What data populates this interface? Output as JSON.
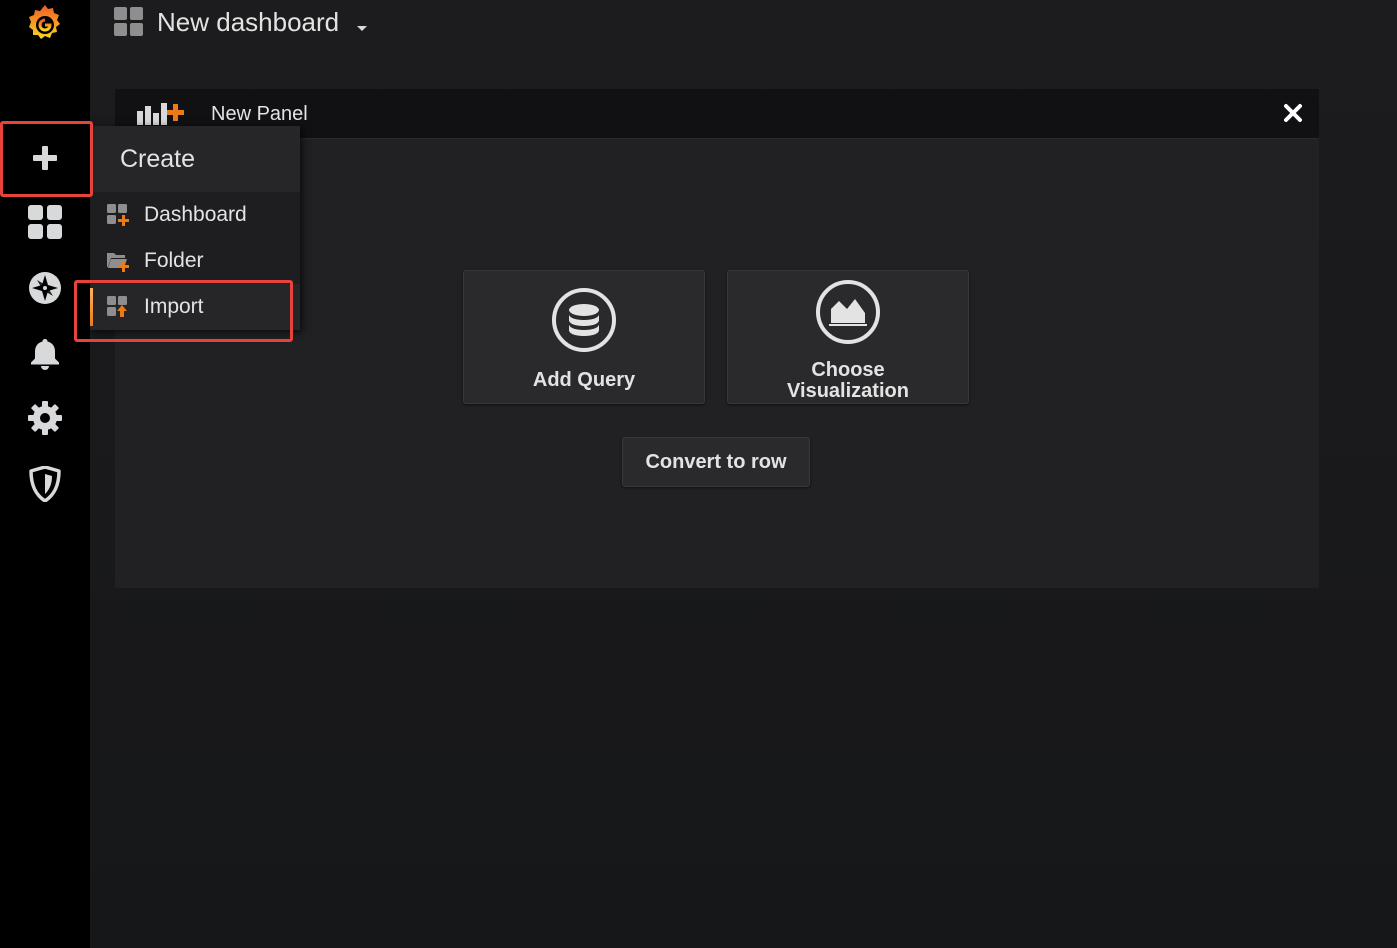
{
  "navbar": {
    "dashboard_title": "New dashboard"
  },
  "sidemenu": {
    "items": [
      {
        "name": "grafana-logo",
        "icon": "grafana-logo-icon"
      },
      {
        "name": "create",
        "icon": "plus-icon",
        "active": true
      },
      {
        "name": "dashboards",
        "icon": "apps-grid-icon"
      },
      {
        "name": "explore",
        "icon": "compass-icon"
      },
      {
        "name": "alerting",
        "icon": "bell-icon"
      },
      {
        "name": "configuration",
        "icon": "gear-icon"
      },
      {
        "name": "server-admin",
        "icon": "shield-icon"
      }
    ],
    "create_menu": {
      "title": "Create",
      "items": [
        {
          "label": "Dashboard",
          "icon": "dashboard-add-icon"
        },
        {
          "label": "Folder",
          "icon": "folder-add-icon"
        },
        {
          "label": "Import",
          "icon": "import-icon",
          "active": true
        }
      ]
    }
  },
  "panel": {
    "title": "New Panel",
    "actions": {
      "add_query": "Add Query",
      "choose_visualization": "Choose Visualization",
      "convert_to_row": "Convert to row"
    }
  },
  "colors": {
    "accent_orange": "#eb7b18",
    "highlight_red": "#e8433b",
    "sidemenu_bg": "#000000",
    "panel_bg": "#212124"
  }
}
